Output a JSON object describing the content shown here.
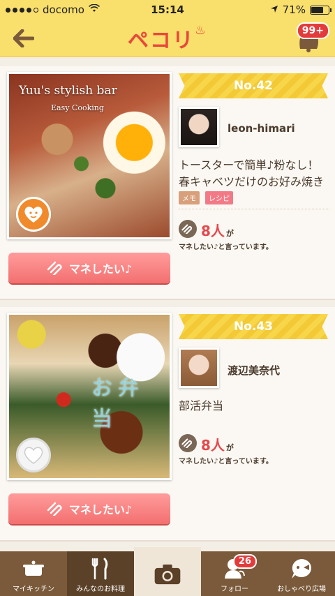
{
  "status_bar": {
    "carrier": "docomo",
    "time": "15:14",
    "battery": "71%",
    "battery_level": 0.71
  },
  "header": {
    "logo": "ペコリ",
    "notification_count": "99+"
  },
  "posts": [
    {
      "number": "No.42",
      "photo_caption": "Yuu's stylish bar",
      "photo_subcaption": "Easy Cooking",
      "user": "leon-himari",
      "title": "トースターで簡単♪粉なし！春キャベツだけのお好み焼き",
      "tags": [
        "メモ",
        "レシピ"
      ],
      "count": "8人",
      "count_suffix": "が",
      "count_text": "マネしたい♪と言っています。",
      "button_label": "マネしたい♪"
    },
    {
      "number": "No.43",
      "photo_overlay": "お弁当",
      "user": "渡辺美奈代",
      "title": "部活弁当",
      "count": "8人",
      "count_suffix": "が",
      "count_text": "マネしたい♪と言っています。",
      "button_label": "マネしたい♪"
    }
  ],
  "tabs": [
    {
      "label": "マイキッチン",
      "icon": "pot-icon"
    },
    {
      "label": "みんなのお料理",
      "icon": "fork-knife-icon"
    },
    {
      "label": "",
      "icon": "camera-icon"
    },
    {
      "label": "フォロー",
      "icon": "follow-icon",
      "badge": "26"
    },
    {
      "label": "おしゃべり広場",
      "icon": "chat-icon"
    }
  ],
  "colors": {
    "header": "#f9df6c",
    "accent_red": "#e9473a",
    "button": "#f36f6f",
    "tab_bar": "#7a5a3a"
  }
}
